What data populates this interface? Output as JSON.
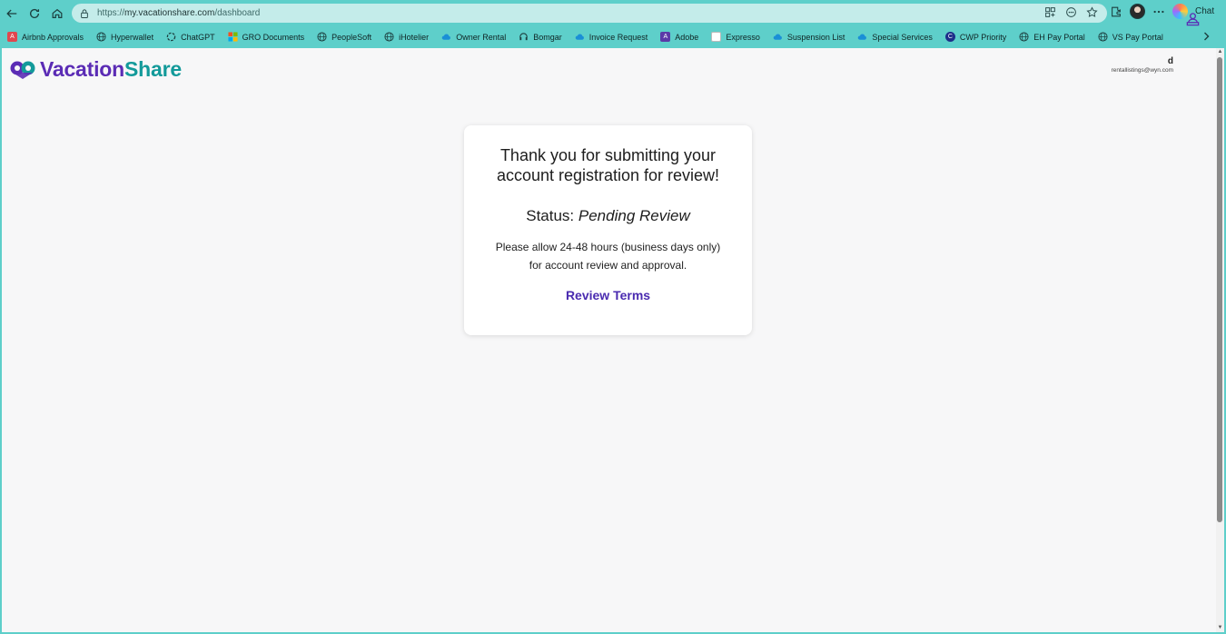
{
  "browser": {
    "url_base": "https://",
    "url_host": "my.vacationshare.com",
    "url_path": "/dashboard",
    "chat_label": "Chat",
    "bookmarks": [
      {
        "label": "Airbnb Approvals",
        "icon": "airbnb-icon",
        "color": "#e0484f"
      },
      {
        "label": "Hyperwallet",
        "icon": "globe-icon",
        "color": ""
      },
      {
        "label": "ChatGPT",
        "icon": "chatgpt-icon",
        "color": ""
      },
      {
        "label": "GRO Documents",
        "icon": "microsoft-icon",
        "color": ""
      },
      {
        "label": "PeopleSoft",
        "icon": "globe-icon",
        "color": ""
      },
      {
        "label": "iHotelier",
        "icon": "globe-icon",
        "color": ""
      },
      {
        "label": "Owner Rental",
        "icon": "cloud-icon",
        "color": "#1a8fd6"
      },
      {
        "label": "Bomgar",
        "icon": "headset-icon",
        "color": ""
      },
      {
        "label": "Invoice Request",
        "icon": "cloud-icon",
        "color": "#1a8fd6"
      },
      {
        "label": "Adobe",
        "icon": "pdf-icon",
        "color": "#5b3aa8"
      },
      {
        "label": "Expresso",
        "icon": "page-icon",
        "color": "#ffffff"
      },
      {
        "label": "Suspension List",
        "icon": "cloud-icon",
        "color": "#1a8fd6"
      },
      {
        "label": "Special Services",
        "icon": "cloud-icon",
        "color": "#1a8fd6"
      },
      {
        "label": "CWP Priority",
        "icon": "cwp-icon",
        "color": "#1d2f8a"
      },
      {
        "label": "EH Pay Portal",
        "icon": "globe-icon",
        "color": ""
      },
      {
        "label": "VS Pay Portal",
        "icon": "globe-icon",
        "color": ""
      }
    ]
  },
  "header": {
    "logo_part1": "Vacation",
    "logo_part2": "Share",
    "user_name": "d",
    "user_email": "rentallistings@wyn.com"
  },
  "card": {
    "title": "Thank you for submitting your account registration for review!",
    "status_label": "Status:",
    "status_value": "Pending Review",
    "note_line1": "Please allow 24-48 hours (business days only)",
    "note_line2": "for account review and approval.",
    "link": "Review Terms"
  },
  "colors": {
    "chrome": "#5ecfca",
    "brand_purple": "#5b2cb5",
    "brand_teal": "#139a9a",
    "link": "#4a2bb0"
  }
}
